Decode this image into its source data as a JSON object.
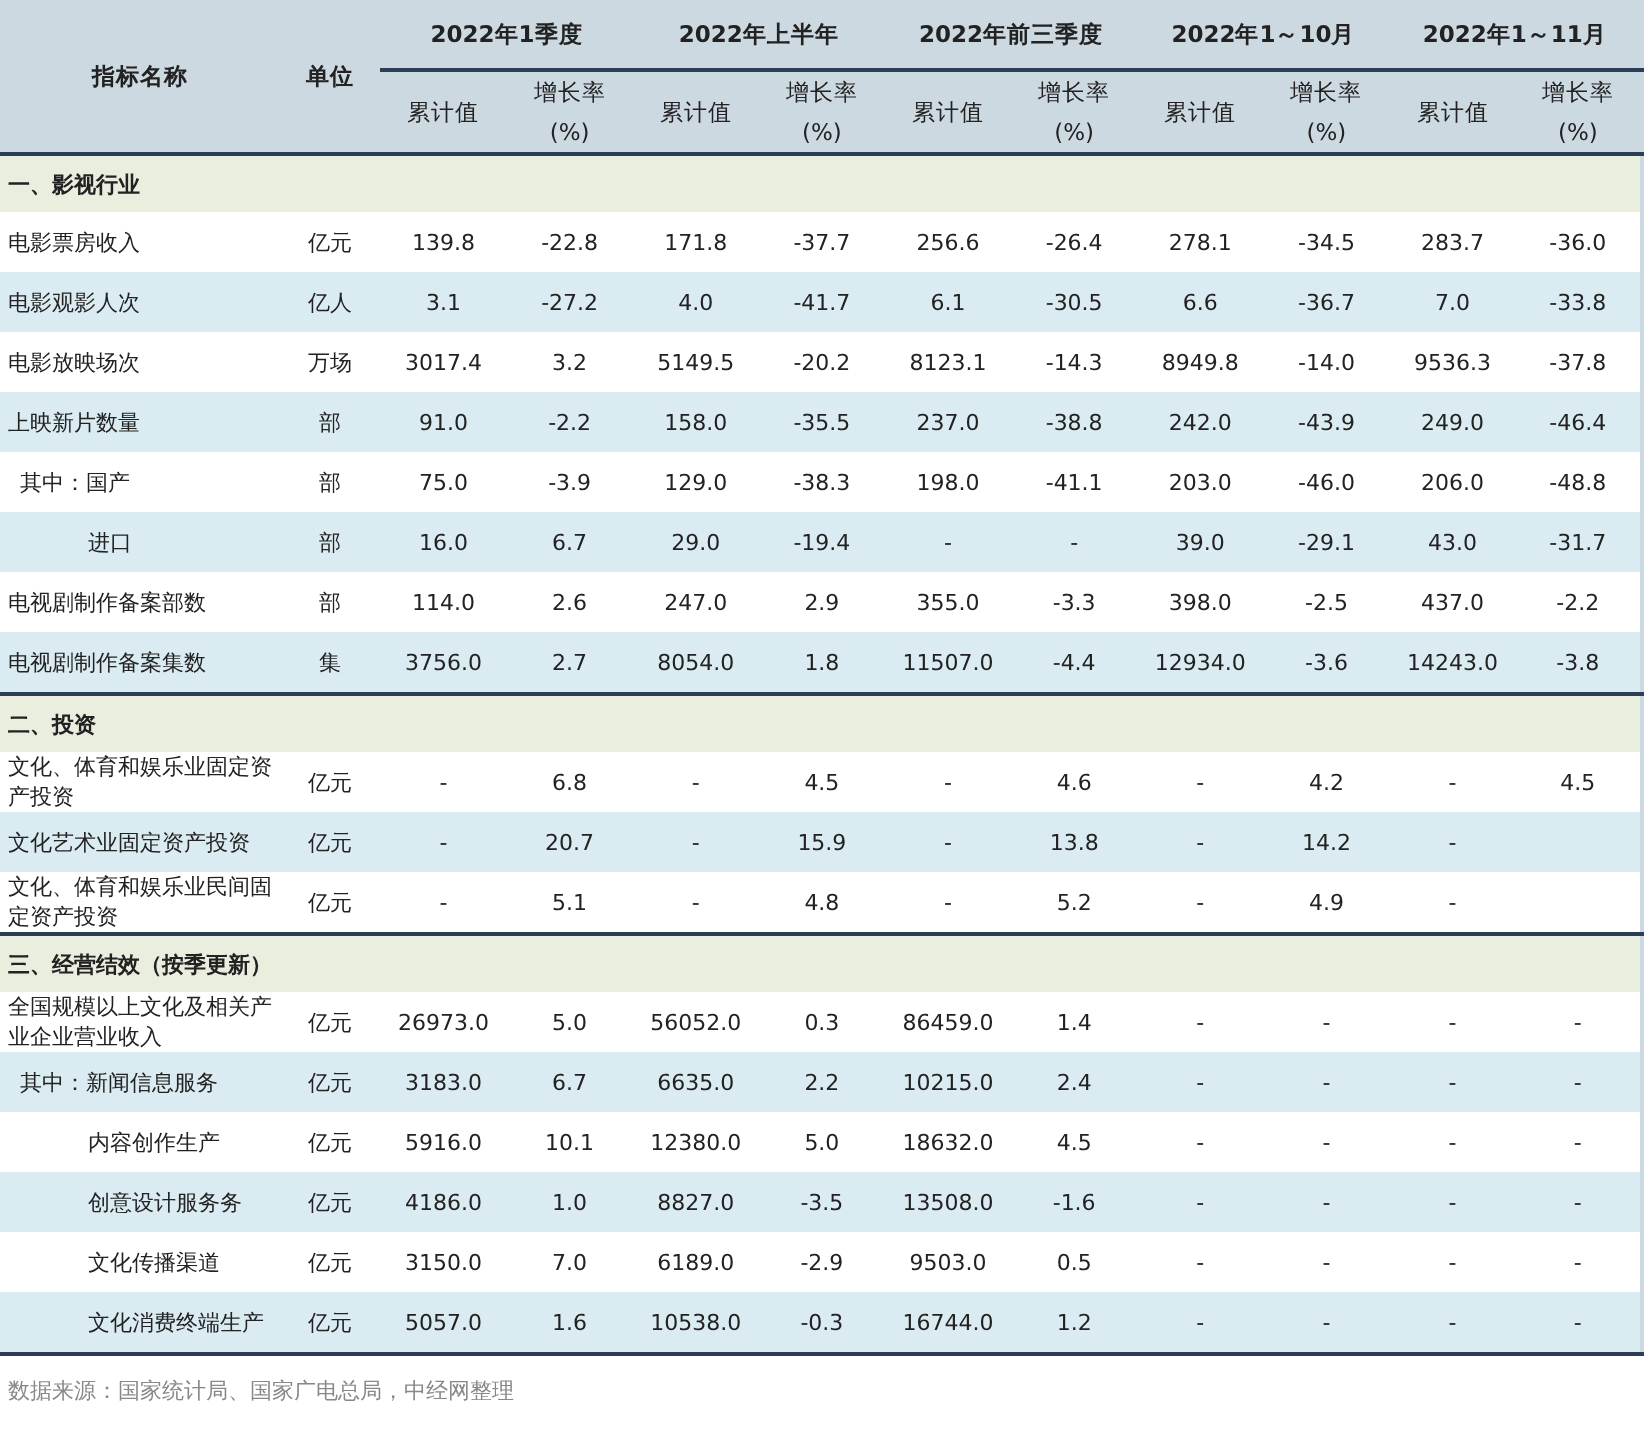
{
  "table": {
    "columns": {
      "name": "指标名称",
      "unit": "单位",
      "periods": [
        {
          "label": "2022年1季度",
          "sub_columns": [
            {
              "label": "累计值"
            },
            {
              "label": "增长率",
              "suffix": "(%)"
            }
          ]
        },
        {
          "label": "2022年上半年",
          "sub_columns": [
            {
              "label": "累计值"
            },
            {
              "label": "增长率",
              "suffix": "(%)"
            }
          ]
        },
        {
          "label": "2022年前三季度",
          "sub_columns": [
            {
              "label": "累计值"
            },
            {
              "label": "增长率",
              "suffix": "(%)"
            }
          ]
        },
        {
          "label": "2022年1～10月",
          "sub_columns": [
            {
              "label": "累计值"
            },
            {
              "label": "增长率",
              "suffix": "(%)"
            }
          ]
        },
        {
          "label": "2022年1～11月",
          "sub_columns": [
            {
              "label": "累计值"
            },
            {
              "label": "增长率",
              "suffix": "(%)"
            }
          ]
        }
      ]
    },
    "sections": [
      {
        "title": "一、影视行业",
        "rows": [
          {
            "name": "电影票房收入",
            "unit": "亿元",
            "cells": [
              "139.8",
              "-22.8",
              "171.8",
              "-37.7",
              "256.6",
              "-26.4",
              "278.1",
              "-34.5",
              "283.7",
              "-36.0"
            ]
          },
          {
            "name": "电影观影人次",
            "unit": "亿人",
            "cells": [
              "3.1",
              "-27.2",
              "4.0",
              "-41.7",
              "6.1",
              "-30.5",
              "6.6",
              "-36.7",
              "7.0",
              "-33.8"
            ]
          },
          {
            "name": "电影放映场次",
            "unit": "万场",
            "cells": [
              "3017.4",
              "3.2",
              "5149.5",
              "-20.2",
              "8123.1",
              "-14.3",
              "8949.8",
              "-14.0",
              "9536.3",
              "-37.8"
            ]
          },
          {
            "name": "上映新片数量",
            "unit": "部",
            "cells": [
              "91.0",
              "-2.2",
              "158.0",
              "-35.5",
              "237.0",
              "-38.8",
              "242.0",
              "-43.9",
              "249.0",
              "-46.4"
            ],
            "children": [
              {
                "name": "其中：国产",
                "unit": "部",
                "cells": [
                  "75.0",
                  "-3.9",
                  "129.0",
                  "-38.3",
                  "198.0",
                  "-41.1",
                  "203.0",
                  "-46.0",
                  "206.0",
                  "-48.8"
                ]
              },
              {
                "name": "进口",
                "unit": "部",
                "cells": [
                  "16.0",
                  "6.7",
                  "29.0",
                  "-19.4",
                  "-",
                  "-",
                  "39.0",
                  "-29.1",
                  "43.0",
                  "-31.7"
                ]
              }
            ]
          },
          {
            "name": "电视剧制作备案部数",
            "unit": "部",
            "cells": [
              "114.0",
              "2.6",
              "247.0",
              "2.9",
              "355.0",
              "-3.3",
              "398.0",
              "-2.5",
              "437.0",
              "-2.2"
            ]
          },
          {
            "name": "电视剧制作备案集数",
            "unit": "集",
            "cells": [
              "3756.0",
              "2.7",
              "8054.0",
              "1.8",
              "11507.0",
              "-4.4",
              "12934.0",
              "-3.6",
              "14243.0",
              "-3.8"
            ]
          }
        ]
      },
      {
        "title": "二、投资",
        "rows": [
          {
            "name": "文化、体育和娱乐业固定资产投资",
            "unit": "亿元",
            "cells": [
              "-",
              "6.8",
              "-",
              "4.5",
              "-",
              "4.6",
              "-",
              "4.2",
              "-",
              "4.5"
            ]
          },
          {
            "name": "文化艺术业固定资产投资",
            "unit": "亿元",
            "cells": [
              "-",
              "20.7",
              "-",
              "15.9",
              "-",
              "13.8",
              "-",
              "14.2",
              "-",
              null
            ]
          },
          {
            "name": "文化、体育和娱乐业民间固定资产投资",
            "unit": "亿元",
            "cells": [
              "-",
              "5.1",
              "-",
              "4.8",
              "-",
              "5.2",
              "-",
              "4.9",
              "-",
              null
            ]
          }
        ]
      },
      {
        "title": "三、经营结效（按季更新）",
        "rows": [
          {
            "name": "全国规模以上文化及相关产业企业营业收入",
            "unit": "亿元",
            "cells": [
              "26973.0",
              "5.0",
              "56052.0",
              "0.3",
              "86459.0",
              "1.4",
              "-",
              "-",
              "-",
              "-"
            ],
            "children": [
              {
                "name": "其中：新闻信息服务",
                "unit": "亿元",
                "cells": [
                  "3183.0",
                  "6.7",
                  "6635.0",
                  "2.2",
                  "10215.0",
                  "2.4",
                  "-",
                  "-",
                  "-",
                  "-"
                ]
              },
              {
                "name": "内容创作生产",
                "unit": "亿元",
                "cells": [
                  "5916.0",
                  "10.1",
                  "12380.0",
                  "5.0",
                  "18632.0",
                  "4.5",
                  "-",
                  "-",
                  "-",
                  "-"
                ]
              },
              {
                "name": "创意设计服务务",
                "unit": "亿元",
                "cells": [
                  "4186.0",
                  "1.0",
                  "8827.0",
                  "-3.5",
                  "13508.0",
                  "-1.6",
                  "-",
                  "-",
                  "-",
                  "-"
                ]
              },
              {
                "name": "文化传播渠道",
                "unit": "亿元",
                "cells": [
                  "3150.0",
                  "7.0",
                  "6189.0",
                  "-2.9",
                  "9503.0",
                  "0.5",
                  "-",
                  "-",
                  "-",
                  "-"
                ]
              },
              {
                "name": "文化消费终端生产",
                "unit": "亿元",
                "cells": [
                  "5057.0",
                  "1.6",
                  "10538.0",
                  "-0.3",
                  "16744.0",
                  "1.2",
                  "-",
                  "-",
                  "-",
                  "-"
                ]
              }
            ]
          }
        ]
      }
    ]
  },
  "source_note": "数据来源：国家统计局、国家广电总局，中经网整理"
}
